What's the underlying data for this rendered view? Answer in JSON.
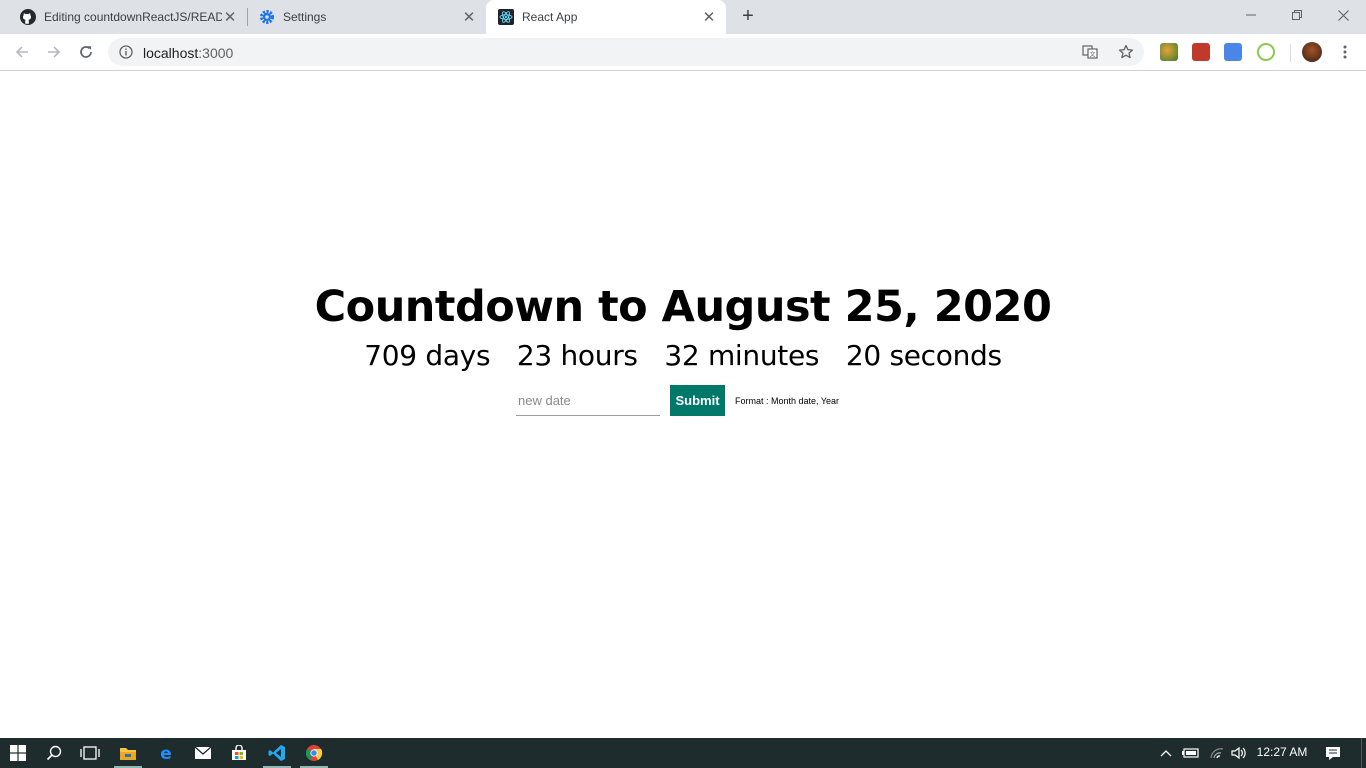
{
  "browser": {
    "tabs": [
      {
        "title": "Editing countdownReactJS/READ",
        "icon": "github-icon"
      },
      {
        "title": "Settings",
        "icon": "gear-icon"
      },
      {
        "title": "React App",
        "icon": "react-icon",
        "active": true
      }
    ],
    "url_host": "localhost",
    "url_port": ":3000"
  },
  "page": {
    "heading": "Countdown to August 25, 2020",
    "countdown": {
      "days": "709 days",
      "hours": "23 hours",
      "minutes": "32 minutes",
      "seconds": "20 seconds"
    },
    "date_input": {
      "placeholder": "new date",
      "value": ""
    },
    "submit_label": "Submit",
    "format_hint": "Format : Month date, Year",
    "accent_color": "#00796b"
  },
  "taskbar": {
    "apps": [
      "windows-start-icon",
      "search-icon",
      "task-view-icon",
      "file-explorer-icon",
      "edge-icon",
      "mail-icon",
      "store-icon",
      "vscode-icon",
      "chrome-icon"
    ],
    "clock": "12:27 AM"
  }
}
